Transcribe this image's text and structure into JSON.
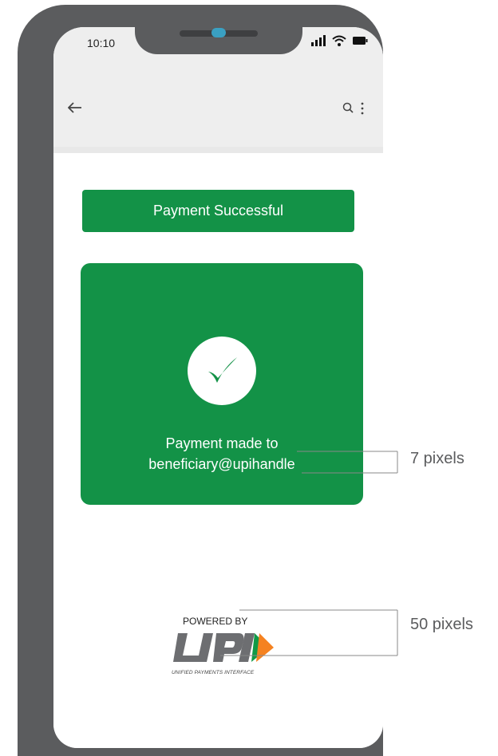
{
  "status_bar": {
    "time": "10:10"
  },
  "banner": {
    "label": "Payment Successful"
  },
  "card": {
    "line1": "Payment made to",
    "line2": "beneficiary@upihandle"
  },
  "upi": {
    "powered_by": "POWERED BY",
    "logo_text": "UPI",
    "tagline": "UNIFIED PAYMENTS INTERFACE"
  },
  "annotations": {
    "text_spacing": "7 pixels",
    "logo_height": "50 pixels"
  },
  "icons": [
    "back-arrow-icon",
    "search-icon",
    "more-vert-icon",
    "signal-icon",
    "wifi-icon",
    "battery-icon",
    "checkmark-icon"
  ],
  "colors": {
    "primary_green": "#139247",
    "phone_frame": "#5b5c5e",
    "upi_orange": "#f58220",
    "upi_green": "#109a46"
  }
}
